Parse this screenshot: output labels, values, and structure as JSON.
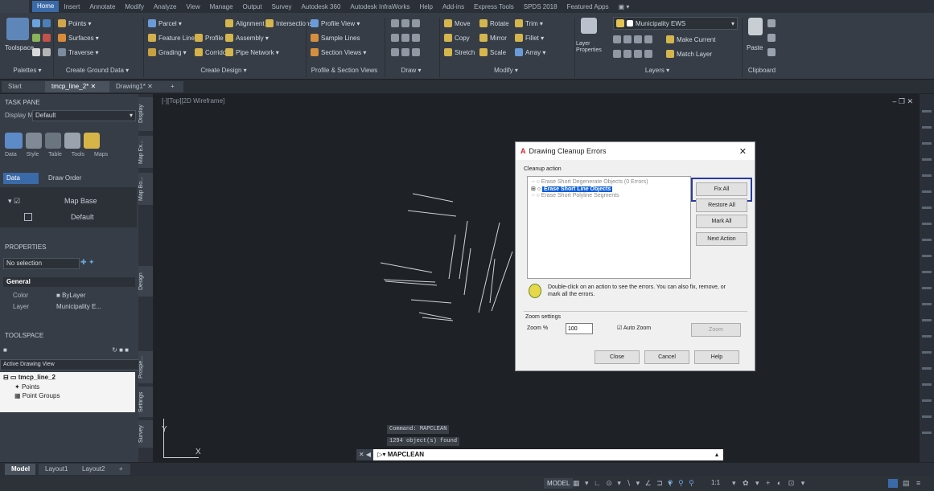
{
  "ribbon_tabs": [
    "Home",
    "Insert",
    "Annotate",
    "Modify",
    "Analyze",
    "View",
    "Manage",
    "Output",
    "Survey",
    "Autodesk 360",
    "Autodesk InfraWorks",
    "Help",
    "Add-ins",
    "Express Tools",
    "SPDS 2018",
    "Featured Apps"
  ],
  "ribbon": {
    "toolspace": "Toolspace",
    "palettes": "Palettes ▾",
    "create_ground_data": "Create Ground Data ▾",
    "points": "Points ▾",
    "surfaces": "Surfaces ▾",
    "traverse": "Traverse ▾",
    "parcel": "Parcel ▾",
    "feature_line": "Feature Line ▾",
    "profile": "Profile ▾",
    "grading": "Grading ▾",
    "corridor": "Corridor",
    "alignment": "Alignment ▾",
    "intersections": "Intersections ▾",
    "assembly": "Assembly ▾",
    "pipe_network": "Pipe Network ▾",
    "create_design": "Create Design ▾",
    "profile_view": "Profile View ▾",
    "sample_lines": "Sample Lines",
    "section_views": "Section Views ▾",
    "profile_section_views": "Profile & Section Views",
    "draw": "Draw ▾",
    "move": "Move",
    "rotate": "Rotate",
    "trim": "Trim ▾",
    "copy": "Copy",
    "mirror": "Mirror",
    "fillet": "Fillet ▾",
    "stretch": "Stretch",
    "scale": "Scale",
    "array": "Array ▾",
    "modify": "Modify ▾",
    "layer_properties": "Layer Properties",
    "layer_name": "Municipality EWS",
    "make_current": "Make Current",
    "match_layer": "Match Layer",
    "layers": "Layers ▾",
    "paste": "Paste",
    "clipboard": "Clipboard"
  },
  "doc_tabs": [
    "Start",
    "tmcp_line_2*",
    "Drawing1*"
  ],
  "taskpane": {
    "title": "TASK PANE",
    "display_map_label": "Display Map",
    "display_map_value": "Default",
    "icons": [
      "Data",
      "Style",
      "Table",
      "Tools",
      "Maps"
    ],
    "data_button": "Data",
    "draw_order": "Draw Order",
    "map_base": "Map Base",
    "default": "Default",
    "side_tabs": [
      "Display",
      "Map Ex...",
      "Map Bo..."
    ]
  },
  "properties": {
    "title": "PROPERTIES",
    "selection": "No selection",
    "section": "General",
    "rows": [
      {
        "label": "Color",
        "value": "ByLayer"
      },
      {
        "label": "Layer",
        "value": "Municipality E..."
      }
    ],
    "side_tab": "Design"
  },
  "toolspace": {
    "title": "TOOLSPACE",
    "view": "Active Drawing View",
    "tree": [
      "tmcp_line_2",
      "Points",
      "Point Groups"
    ],
    "side_tabs": [
      "Prospe...",
      "Settings",
      "Survey"
    ]
  },
  "canvas": {
    "viewport_label": "[-][Top][2D Wireframe]",
    "axis_x": "X",
    "axis_y": "Y",
    "command_history": [
      "Command: MAPCLEAN",
      "1294 object(s) found"
    ],
    "command_input": "MAPCLEAN",
    "window_controls": "– ❐ ✕"
  },
  "dialog": {
    "title": "Drawing Cleanup Errors",
    "cleanup_action_label": "Cleanup action",
    "actions": [
      {
        "label": "Erase Short Degenerate Objects (0 Errors)",
        "selected": false
      },
      {
        "label": "Erase Short Line Objects",
        "selected": true
      },
      {
        "label": "Erase Short Polyline Segments",
        "selected": false
      }
    ],
    "buttons": {
      "fix_all": "Fix All",
      "restore_all": "Restore All",
      "mark_all": "Mark All",
      "next_action": "Next Action"
    },
    "hint": "Double-click on an action to see the errors. You can also fix, remove, or mark all the errors.",
    "zoom_settings": "Zoom settings",
    "zoom_percent_label": "Zoom %",
    "zoom_value": "100",
    "auto_zoom": "Auto Zoom",
    "zoom_button": "Zoom",
    "close": "Close",
    "cancel": "Cancel",
    "help": "Help"
  },
  "layout_tabs": [
    "Model",
    "Layout1",
    "Layout2",
    "+"
  ],
  "statusbar": {
    "model": "MODEL",
    "scale": "1:1"
  },
  "colors": {
    "accent": "#3b6aa8",
    "selection": "#0a5cd6",
    "dialog_highlight": "#2a3a9e"
  }
}
